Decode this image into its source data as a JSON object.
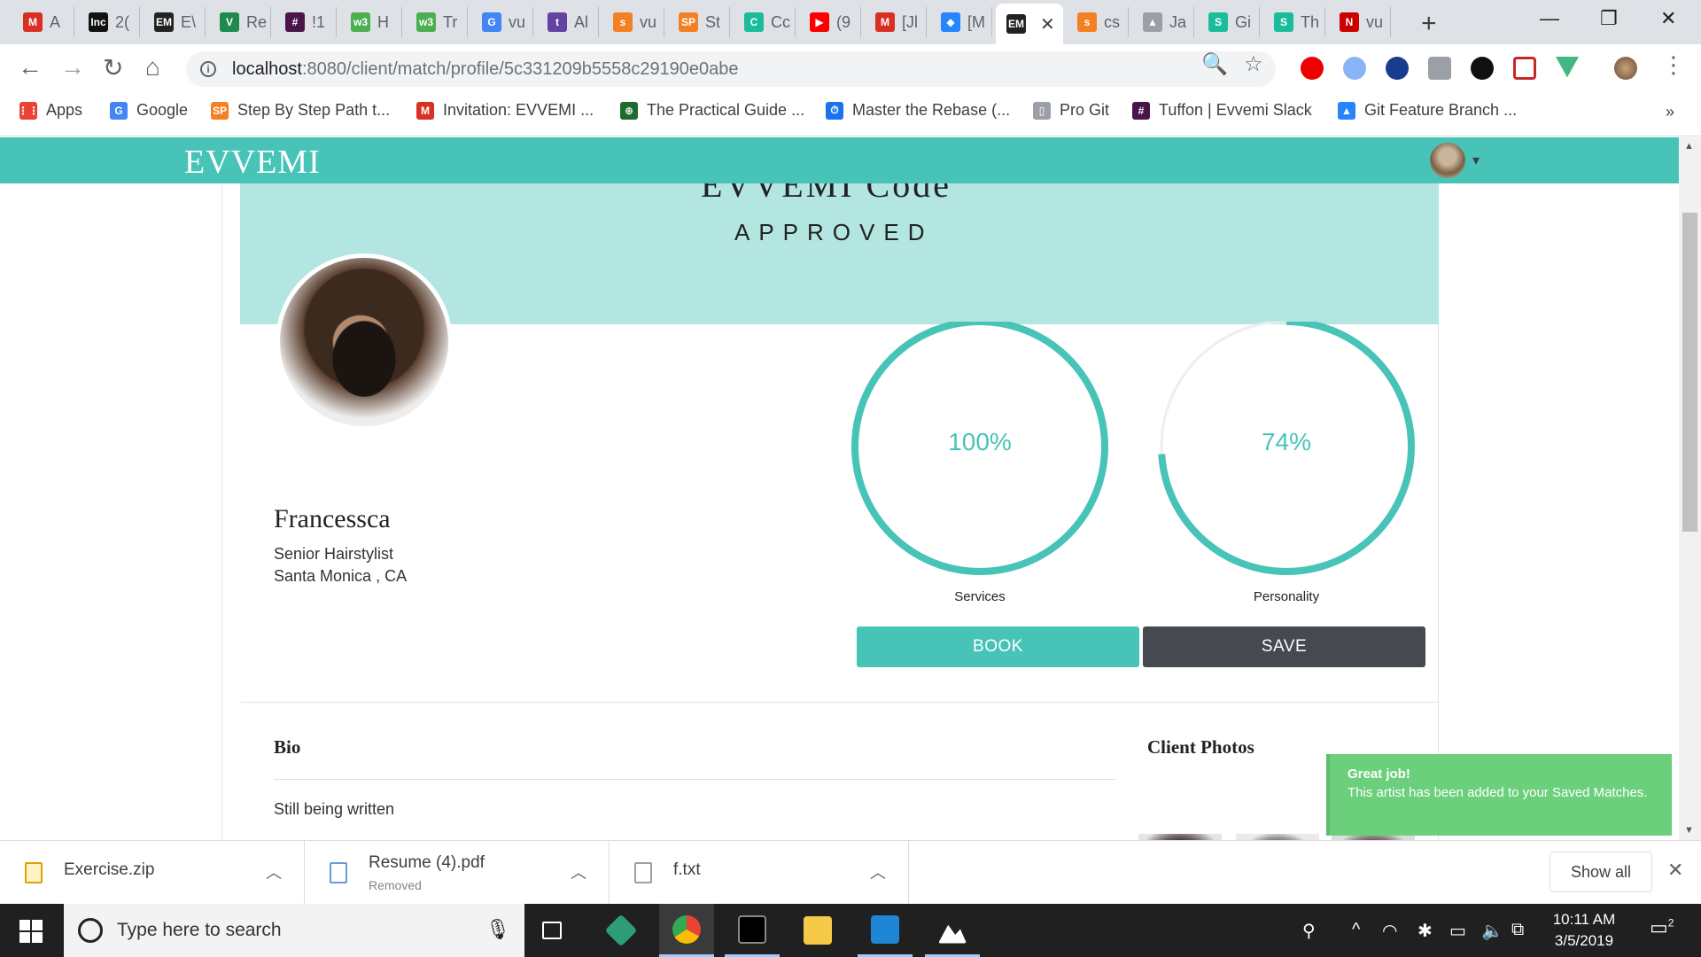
{
  "tabs": [
    {
      "label": "A",
      "icon": "gmail-icon",
      "color": "#d93025"
    },
    {
      "label": "2(",
      "icon": "inc-icon",
      "color": "#111111"
    },
    {
      "label": "E\\",
      "icon": "evvemi-icon",
      "color": "#222222"
    },
    {
      "label": "Re",
      "icon": "vuetify-icon",
      "color": "#1f8a4c"
    },
    {
      "label": "!1",
      "icon": "slack-icon",
      "color": "#4a154b"
    },
    {
      "label": "H",
      "icon": "w3schools-icon",
      "color": "#4caf50"
    },
    {
      "label": "Tr",
      "icon": "w3schools-icon",
      "color": "#4caf50"
    },
    {
      "label": "vu",
      "icon": "google-icon",
      "color": "#4285f4"
    },
    {
      "label": "Al",
      "icon": "twitch-icon",
      "color": "#6441a5"
    },
    {
      "label": "vu",
      "icon": "stackoverflow-icon",
      "color": "#f48024"
    },
    {
      "label": "St",
      "icon": "stepbystep-icon",
      "color": "#f48024"
    },
    {
      "label": "Cc",
      "icon": "codementor-icon",
      "color": "#1abc9c"
    },
    {
      "label": "(9",
      "icon": "youtube-icon",
      "color": "#ff0000"
    },
    {
      "label": "[Jl",
      "icon": "gmail-icon",
      "color": "#d93025"
    },
    {
      "label": "[M",
      "icon": "jira-icon",
      "color": "#2684ff"
    },
    {
      "label": "",
      "icon": "evvemi-icon",
      "color": "#222222",
      "active": true
    },
    {
      "label": "cs",
      "icon": "stackoverflow-icon",
      "color": "#f48024"
    },
    {
      "label": "Ja",
      "icon": "image-icon",
      "color": "#9aa0a6"
    },
    {
      "label": "Gi",
      "icon": "sheets-icon",
      "color": "#1abc9c"
    },
    {
      "label": "Th",
      "icon": "sheets-icon",
      "color": "#1abc9c"
    },
    {
      "label": "vu",
      "icon": "n-icon",
      "color": "#cc0000"
    }
  ],
  "tab_initials": [
    "M",
    "Inc",
    "EM",
    "V",
    "#",
    "w3",
    "w3",
    "G",
    "t",
    "s",
    "SP",
    "C",
    "▶",
    "M",
    "◆",
    "EM",
    "s",
    "▲",
    "S",
    "S",
    "N"
  ],
  "active_tab_close": "✕",
  "new_tab": "+",
  "window_controls": {
    "minimize": "—",
    "restore": "❐",
    "close": "✕"
  },
  "toolbar": {
    "back": "←",
    "forward": "→",
    "reload": "↻",
    "home": "⌂",
    "url_host": "localhost",
    "url_path": ":8080/client/match/profile/5c331209b5558c29190e0abe",
    "zoom": "🔍",
    "star": "☆",
    "menu": "⋮"
  },
  "bookmarks": [
    {
      "label": "Apps",
      "icon": "apps-icon",
      "color": "#ea4335"
    },
    {
      "label": "Google",
      "icon": "google-icon",
      "color": "#4285f4"
    },
    {
      "label": "Step By Step Path t...",
      "icon": "stepbystep-icon",
      "color": "#f48024"
    },
    {
      "label": "Invitation: EVVEMI ...",
      "icon": "gmail-icon",
      "color": "#d93025"
    },
    {
      "label": "The Practical Guide ...",
      "icon": "udemy-icon",
      "color": "#1e6b2e"
    },
    {
      "label": "Master the Rebase (...",
      "icon": "timer-icon",
      "color": "#1a73e8"
    },
    {
      "label": "Pro Git",
      "icon": "page-icon",
      "color": "#9aa0a6"
    },
    {
      "label": "Tuffon | Evvemi Slack",
      "icon": "slack-icon",
      "color": "#4a154b"
    },
    {
      "label": "Git Feature Branch ...",
      "icon": "atlassian-icon",
      "color": "#2684ff"
    }
  ],
  "bookmarks_more": "»",
  "bookmark_initials": [
    "⋮⋮",
    "G",
    "SP",
    "M",
    "⊕",
    "⏱",
    "▯",
    "#",
    "▲"
  ],
  "app": {
    "logo": "EVVEMI",
    "user_caret": "▾",
    "banner_script": "EVVEMI Code",
    "banner_title": "APPROVED",
    "accent": "#47c3b8",
    "dark": "#464a50"
  },
  "profile": {
    "name": "Francessca",
    "title": "Senior Hairstylist",
    "location": "Santa Monica , CA"
  },
  "scores": [
    {
      "label": "100%",
      "caption": "Services",
      "fraction": 1.0
    },
    {
      "label": "74%",
      "caption": "Personality",
      "fraction": 0.74
    }
  ],
  "buttons": {
    "book": "BOOK",
    "save": "SAVE"
  },
  "bio": {
    "heading": "Bio",
    "text": "Still being written"
  },
  "client_photos": {
    "heading": "Client Photos"
  },
  "toast": {
    "title": "Great job!",
    "message": "This artist has been added to your Saved Matches.",
    "color": "#6bcf7c"
  },
  "downloads": [
    {
      "name": "Exercise.zip",
      "sub": ""
    },
    {
      "name": "Resume (4).pdf",
      "sub": "Removed"
    },
    {
      "name": "f.txt",
      "sub": ""
    }
  ],
  "download_caret": "︿",
  "show_all": "Show all",
  "shelf_close": "✕",
  "taskbar": {
    "search_placeholder": "Type here to search",
    "mic": "🎙",
    "clock_time": "10:11 AM",
    "clock_date": "3/5/2019",
    "notifications": "2",
    "tray_icons": [
      "⚲",
      "^",
      "◠",
      "✱",
      "▭",
      "🔈",
      "⧉"
    ],
    "tray_names": [
      "people-icon",
      "chevron-up-icon",
      "wifi-icon",
      "bluetooth-icon",
      "battery-icon",
      "volume-icon",
      "dropbox-icon"
    ]
  }
}
